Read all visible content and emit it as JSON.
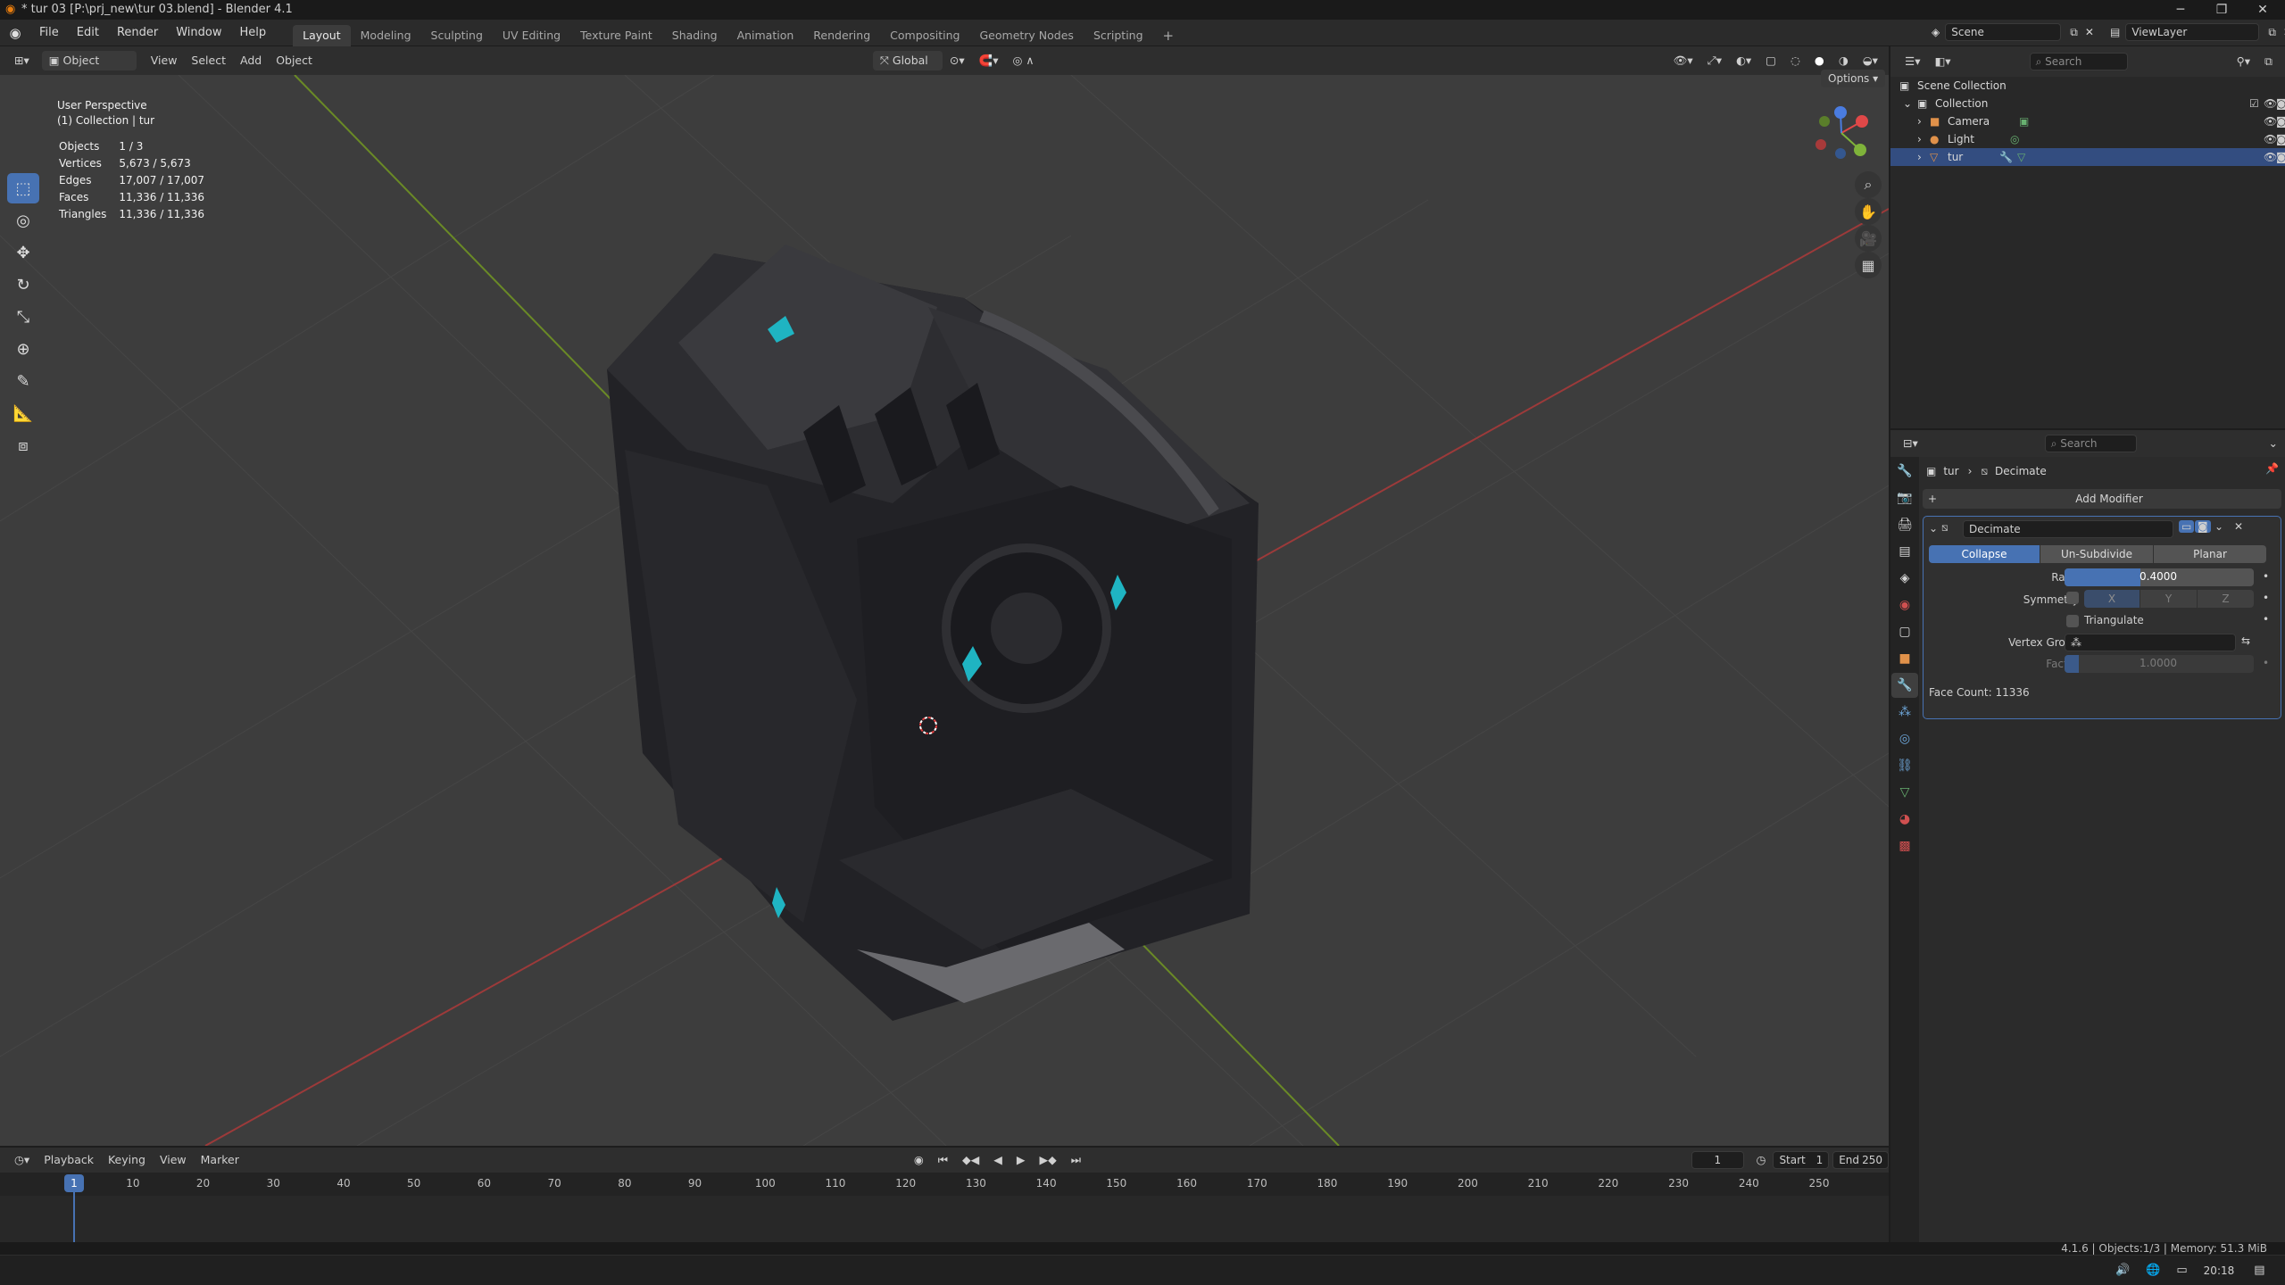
{
  "window": {
    "title": "* tur 03 [P:\\prj_new\\tur 03.blend] - Blender 4.1"
  },
  "menu": [
    "File",
    "Edit",
    "Render",
    "Window",
    "Help"
  ],
  "workspaces": [
    "Layout",
    "Modeling",
    "Sculpting",
    "UV Editing",
    "Texture Paint",
    "Shading",
    "Animation",
    "Rendering",
    "Compositing",
    "Geometry Nodes",
    "Scripting"
  ],
  "active_workspace": "Layout",
  "scene": {
    "name": "Scene",
    "view_layer": "ViewLayer"
  },
  "viewport_header": {
    "mode": "Object Mode",
    "menus": [
      "View",
      "Select",
      "Add",
      "Object"
    ],
    "transform_orientation": "Global",
    "options_label": "Options"
  },
  "viewport": {
    "perspective_label": "User Perspective",
    "collection_label": "(1) Collection | tur",
    "stats": [
      {
        "label": "Objects",
        "value": "1 / 3"
      },
      {
        "label": "Vertices",
        "value": "5,673 / 5,673"
      },
      {
        "label": "Edges",
        "value": "17,007 / 17,007"
      },
      {
        "label": "Faces",
        "value": "11,336 / 11,336"
      },
      {
        "label": "Triangles",
        "value": "11,336 / 11,336"
      }
    ],
    "tools": [
      "select-box-icon",
      "cursor-icon",
      "move-icon",
      "rotate-icon",
      "scale-icon",
      "transform-icon",
      "annotate-icon",
      "measure-icon",
      "add-cube-icon"
    ]
  },
  "timeline": {
    "menus": [
      "Playback",
      "Keying",
      "View",
      "Marker"
    ],
    "current_frame": "1",
    "start_label": "Start",
    "start": "1",
    "end_label": "End",
    "end": "250",
    "ticks": [
      "1",
      "10",
      "20",
      "30",
      "40",
      "50",
      "60",
      "70",
      "80",
      "90",
      "100",
      "110",
      "120",
      "130",
      "140",
      "150",
      "160",
      "170",
      "180",
      "190",
      "200",
      "210",
      "220",
      "230",
      "240",
      "250"
    ]
  },
  "outliner": {
    "search_placeholder": "Search",
    "root": "Scene Collection",
    "collection": "Collection",
    "items": [
      {
        "name": "Camera"
      },
      {
        "name": "Light"
      },
      {
        "name": "tur"
      }
    ]
  },
  "properties": {
    "search_placeholder": "Search",
    "breadcrumb_object": "tur",
    "breadcrumb_modifier": "Decimate",
    "add_modifier_label": "Add Modifier",
    "modifier": {
      "name": "Decimate",
      "modes": [
        "Collapse",
        "Un-Subdivide",
        "Planar"
      ],
      "active_mode": "Collapse",
      "ratio_label": "Ratio",
      "ratio": "0.4000",
      "ratio_fraction": 0.4,
      "symmetry_label": "Symmetry",
      "symmetry_axes": [
        "X",
        "Y",
        "Z"
      ],
      "triangulate_label": "Triangulate",
      "vertex_group_label": "Vertex Group",
      "factor_label": "Factor",
      "factor": "1.0000",
      "face_count": "Face Count: 11336"
    }
  },
  "statusbar": {
    "right": "4.1.6 | Objects:1/3 | Memory: 51.3 MiB"
  },
  "taskbar": {
    "time": "20:18"
  }
}
